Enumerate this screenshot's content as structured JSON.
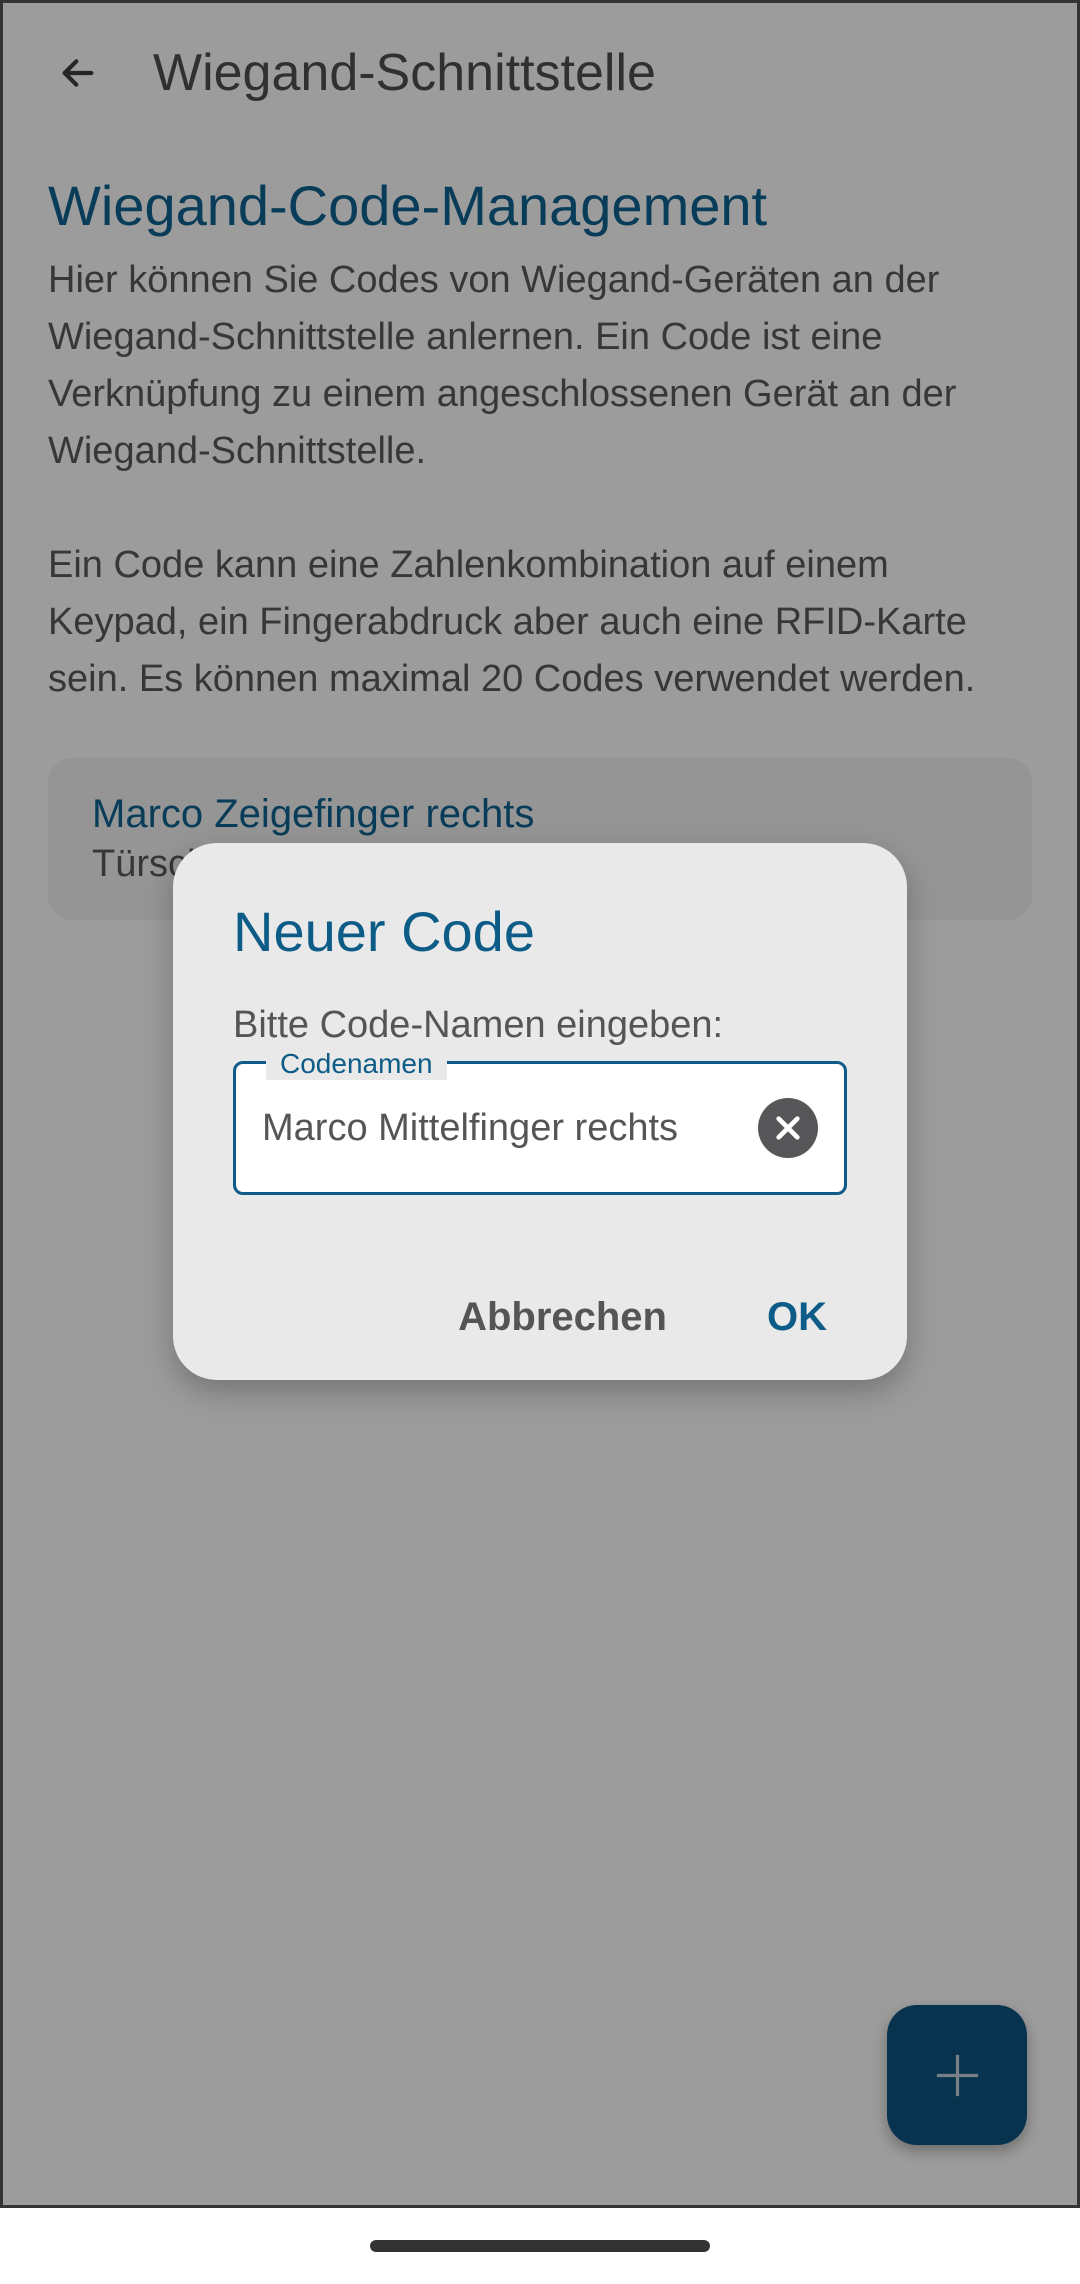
{
  "header": {
    "title": "Wiegand-Schnittstelle"
  },
  "main": {
    "section_title": "Wiegand-Code-Management",
    "description": "Hier können Sie Codes von Wiegand-Geräten an der Wiegand-Schnittstelle anlernen. Ein Code ist eine Verknüpfung zu einem angeschlossenen Gerät an der Wiegand-Schnittstelle.\n\nEin Code kann eine Zahlenkombination auf einem Keypad, ein Fingerabdruck aber auch eine RFID-Karte sein. Es können maximal 20 Codes verwendet werden.",
    "codes": [
      {
        "title": "Marco Zeigefinger rechts",
        "subtitle": "Türschloss"
      }
    ]
  },
  "dialog": {
    "title": "Neuer Code",
    "prompt": "Bitte Code-Namen eingeben:",
    "input_label": "Codenamen",
    "input_value": "Marco Mittelfinger rechts",
    "cancel_label": "Abbrechen",
    "ok_label": "OK"
  }
}
